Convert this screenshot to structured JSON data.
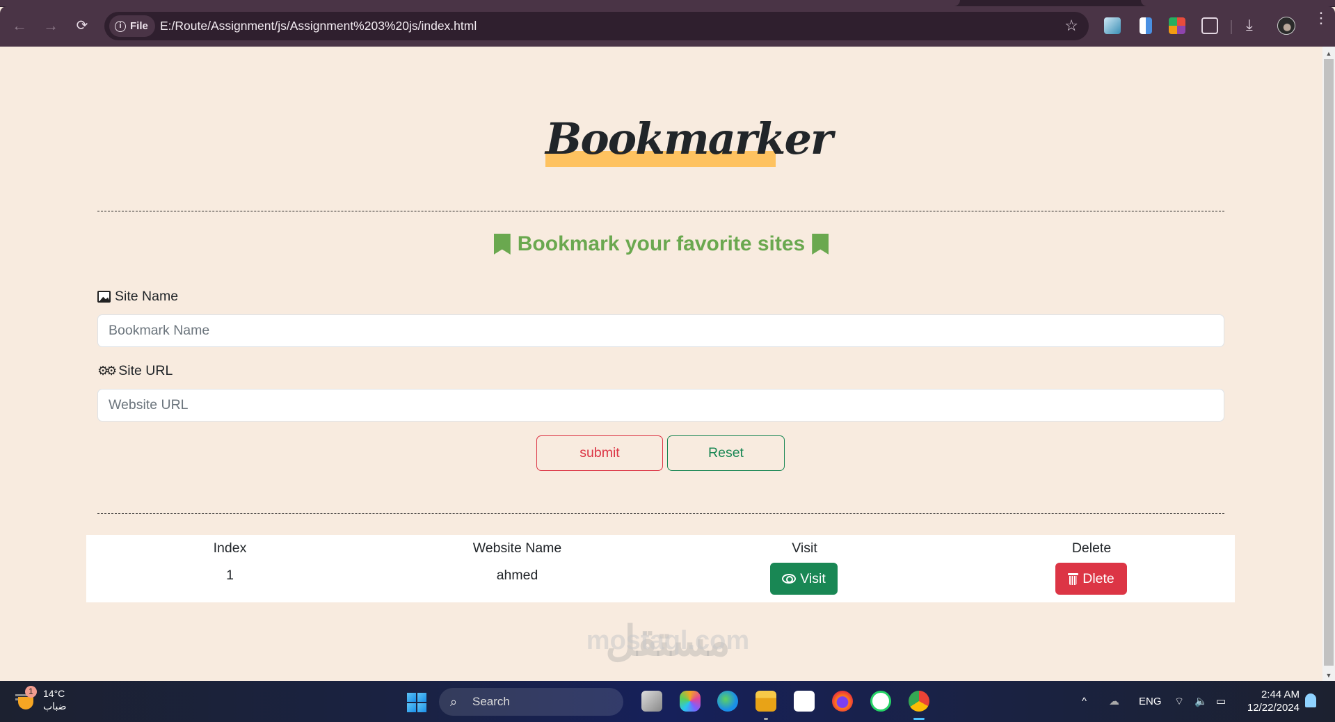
{
  "browser": {
    "nav": {
      "back_icon": "←",
      "forward_icon": "→",
      "reload_icon": "⟳"
    },
    "omnibox": {
      "chip_label": "File",
      "info_icon": "i",
      "url": "E:/Route/Assignment/js/Assignment%203%20js/index.html",
      "bookmark_star": "☆"
    },
    "extensions": [
      "image-uploader-extension",
      "document-extension",
      "color-picker-extension",
      "extensions-puzzle"
    ],
    "download_icon": "⤓",
    "menu_icon": "⋮"
  },
  "page": {
    "title": "Bookmarker",
    "subtitle": "Bookmark your favorite sites",
    "form": {
      "site_name_label": "Site Name",
      "site_name_placeholder": "Bookmark Name",
      "site_name_value": "",
      "site_url_label": "Site URL",
      "site_url_placeholder": "Website URL",
      "site_url_value": "",
      "submit_label": "submit",
      "reset_label": "Reset"
    },
    "table": {
      "headers": [
        "Index",
        "Website Name",
        "Visit",
        "Delete"
      ],
      "rows": [
        {
          "index": "1",
          "name": "ahmed",
          "visit_label": "Visit",
          "delete_label": "Dlete"
        }
      ]
    },
    "colors": {
      "background": "#f8ebdf",
      "title_highlight": "#fec260",
      "subtitle": "#6aa84f",
      "danger": "#dc3545",
      "success": "#198754"
    },
    "watermark": {
      "arabic": "مستقل",
      "latin": "mostaql.com"
    }
  },
  "taskbar": {
    "weather": {
      "temp": "14°C",
      "condition": "ضباب",
      "badge": "1"
    },
    "search_label": "Search",
    "apps": [
      "task-view",
      "copilot",
      "edge",
      "file-explorer",
      "microsoft-store",
      "firefox",
      "whatsapp",
      "chrome"
    ],
    "tray": {
      "chevron": "^",
      "language": "ENG",
      "wifi": "wifi",
      "volume": "🔊",
      "battery": "battery"
    },
    "clock": {
      "time": "2:44 AM",
      "date": "12/22/2024"
    }
  }
}
